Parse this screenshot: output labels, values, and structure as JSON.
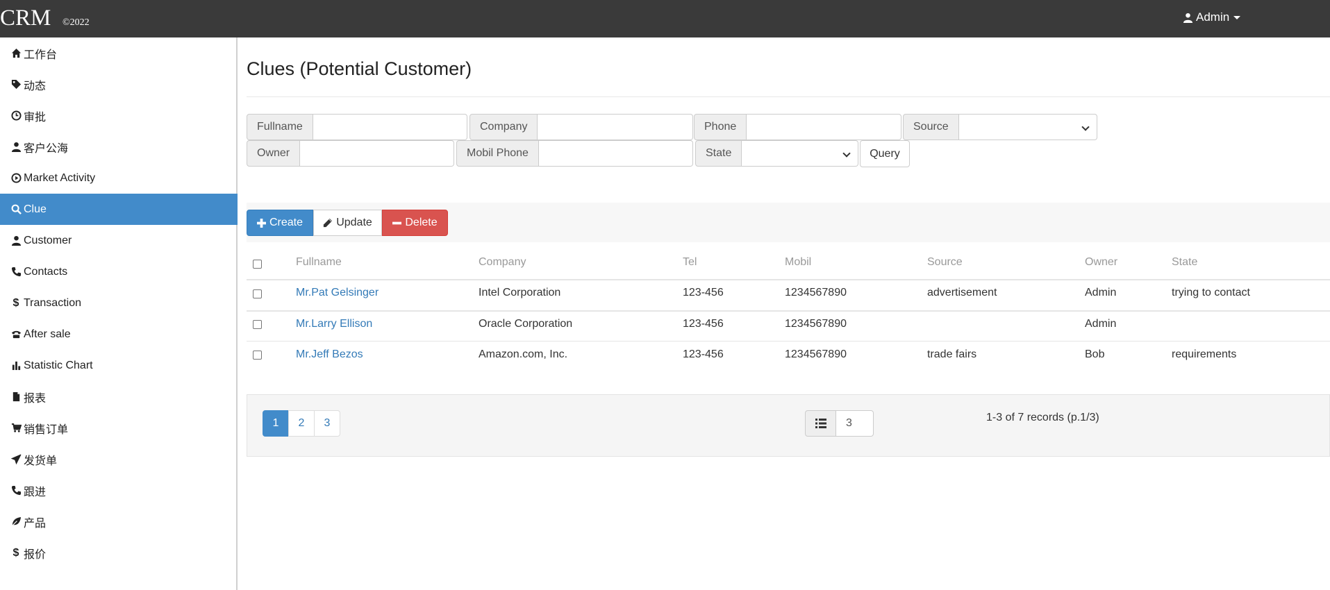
{
  "header": {
    "brand": "CRM",
    "year": "©2022",
    "user": "Admin"
  },
  "sidebar": {
    "items": [
      {
        "label": "工作台",
        "icon": "home-icon"
      },
      {
        "label": "动态",
        "icon": "tag-icon"
      },
      {
        "label": "审批",
        "icon": "clock-icon"
      },
      {
        "label": "客户公海",
        "icon": "user-icon"
      },
      {
        "label": "Market Activity",
        "icon": "play-circle-icon"
      },
      {
        "label": "Clue",
        "icon": "search-icon",
        "active": true
      },
      {
        "label": "Customer",
        "icon": "user-icon"
      },
      {
        "label": "Contacts",
        "icon": "phone-icon"
      },
      {
        "label": "Transaction",
        "icon": "dollar-icon"
      },
      {
        "label": "After sale",
        "icon": "phone-alt-icon"
      },
      {
        "label": "Statistic Chart",
        "icon": "stats-icon"
      },
      {
        "label": "报表",
        "icon": "file-icon"
      },
      {
        "label": "销售订单",
        "icon": "cart-icon"
      },
      {
        "label": "发货单",
        "icon": "send-icon"
      },
      {
        "label": "跟进",
        "icon": "phone-icon"
      },
      {
        "label": "产品",
        "icon": "leaf-icon"
      },
      {
        "label": "报价",
        "icon": "dollar-icon"
      }
    ]
  },
  "main": {
    "title": "Clues (Potential Customer)",
    "filters": {
      "fullname": {
        "label": "Fullname",
        "value": ""
      },
      "company": {
        "label": "Company",
        "value": ""
      },
      "phone": {
        "label": "Phone",
        "value": ""
      },
      "source": {
        "label": "Source",
        "value": ""
      },
      "owner": {
        "label": "Owner",
        "value": ""
      },
      "mobile": {
        "label": "Mobil Phone",
        "value": ""
      },
      "state": {
        "label": "State",
        "value": ""
      },
      "query_label": "Query"
    },
    "toolbar": {
      "create": "Create",
      "update": "Update",
      "delete": "Delete"
    },
    "table": {
      "columns": [
        "Fullname",
        "Company",
        "Tel",
        "Mobil",
        "Source",
        "Owner",
        "State"
      ],
      "rows": [
        {
          "fullname": "Mr.Pat Gelsinger",
          "company": "Intel Corporation",
          "tel": "123-456",
          "mobile": "1234567890",
          "source": "advertisement",
          "owner": "Admin",
          "state": "trying to contact"
        },
        {
          "fullname": "Mr.Larry Ellison",
          "company": "Oracle Corporation",
          "tel": "123-456",
          "mobile": "1234567890",
          "source": "",
          "owner": "Admin",
          "state": ""
        },
        {
          "fullname": "Mr.Jeff Bezos",
          "company": "Amazon.com, Inc.",
          "tel": "123-456",
          "mobile": "1234567890",
          "source": "trade fairs",
          "owner": "Bob",
          "state": "requirements"
        }
      ]
    },
    "pagination": {
      "pages": [
        "1",
        "2",
        "3"
      ],
      "current": "1",
      "page_size": "3",
      "summary": "1-3 of 7 records (p.1/3)"
    }
  },
  "colors": {
    "topbar": "#3a3a3a",
    "primary": "#428bca",
    "danger": "#d9534f",
    "link": "#337ab7"
  }
}
